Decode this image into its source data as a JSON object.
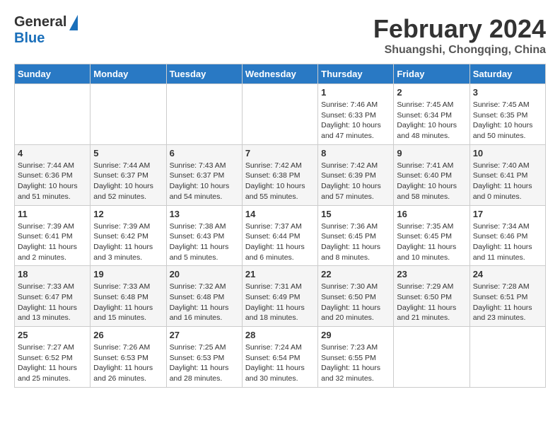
{
  "header": {
    "logo_general": "General",
    "logo_blue": "Blue",
    "title": "February 2024",
    "location": "Shuangshi, Chongqing, China"
  },
  "days_of_week": [
    "Sunday",
    "Monday",
    "Tuesday",
    "Wednesday",
    "Thursday",
    "Friday",
    "Saturday"
  ],
  "weeks": [
    [
      {
        "day": "",
        "sunrise": "",
        "sunset": "",
        "daylight": ""
      },
      {
        "day": "",
        "sunrise": "",
        "sunset": "",
        "daylight": ""
      },
      {
        "day": "",
        "sunrise": "",
        "sunset": "",
        "daylight": ""
      },
      {
        "day": "",
        "sunrise": "",
        "sunset": "",
        "daylight": ""
      },
      {
        "day": "1",
        "sunrise": "Sunrise: 7:46 AM",
        "sunset": "Sunset: 6:33 PM",
        "daylight": "Daylight: 10 hours and 47 minutes."
      },
      {
        "day": "2",
        "sunrise": "Sunrise: 7:45 AM",
        "sunset": "Sunset: 6:34 PM",
        "daylight": "Daylight: 10 hours and 48 minutes."
      },
      {
        "day": "3",
        "sunrise": "Sunrise: 7:45 AM",
        "sunset": "Sunset: 6:35 PM",
        "daylight": "Daylight: 10 hours and 50 minutes."
      }
    ],
    [
      {
        "day": "4",
        "sunrise": "Sunrise: 7:44 AM",
        "sunset": "Sunset: 6:36 PM",
        "daylight": "Daylight: 10 hours and 51 minutes."
      },
      {
        "day": "5",
        "sunrise": "Sunrise: 7:44 AM",
        "sunset": "Sunset: 6:37 PM",
        "daylight": "Daylight: 10 hours and 52 minutes."
      },
      {
        "day": "6",
        "sunrise": "Sunrise: 7:43 AM",
        "sunset": "Sunset: 6:37 PM",
        "daylight": "Daylight: 10 hours and 54 minutes."
      },
      {
        "day": "7",
        "sunrise": "Sunrise: 7:42 AM",
        "sunset": "Sunset: 6:38 PM",
        "daylight": "Daylight: 10 hours and 55 minutes."
      },
      {
        "day": "8",
        "sunrise": "Sunrise: 7:42 AM",
        "sunset": "Sunset: 6:39 PM",
        "daylight": "Daylight: 10 hours and 57 minutes."
      },
      {
        "day": "9",
        "sunrise": "Sunrise: 7:41 AM",
        "sunset": "Sunset: 6:40 PM",
        "daylight": "Daylight: 10 hours and 58 minutes."
      },
      {
        "day": "10",
        "sunrise": "Sunrise: 7:40 AM",
        "sunset": "Sunset: 6:41 PM",
        "daylight": "Daylight: 11 hours and 0 minutes."
      }
    ],
    [
      {
        "day": "11",
        "sunrise": "Sunrise: 7:39 AM",
        "sunset": "Sunset: 6:41 PM",
        "daylight": "Daylight: 11 hours and 2 minutes."
      },
      {
        "day": "12",
        "sunrise": "Sunrise: 7:39 AM",
        "sunset": "Sunset: 6:42 PM",
        "daylight": "Daylight: 11 hours and 3 minutes."
      },
      {
        "day": "13",
        "sunrise": "Sunrise: 7:38 AM",
        "sunset": "Sunset: 6:43 PM",
        "daylight": "Daylight: 11 hours and 5 minutes."
      },
      {
        "day": "14",
        "sunrise": "Sunrise: 7:37 AM",
        "sunset": "Sunset: 6:44 PM",
        "daylight": "Daylight: 11 hours and 6 minutes."
      },
      {
        "day": "15",
        "sunrise": "Sunrise: 7:36 AM",
        "sunset": "Sunset: 6:45 PM",
        "daylight": "Daylight: 11 hours and 8 minutes."
      },
      {
        "day": "16",
        "sunrise": "Sunrise: 7:35 AM",
        "sunset": "Sunset: 6:45 PM",
        "daylight": "Daylight: 11 hours and 10 minutes."
      },
      {
        "day": "17",
        "sunrise": "Sunrise: 7:34 AM",
        "sunset": "Sunset: 6:46 PM",
        "daylight": "Daylight: 11 hours and 11 minutes."
      }
    ],
    [
      {
        "day": "18",
        "sunrise": "Sunrise: 7:33 AM",
        "sunset": "Sunset: 6:47 PM",
        "daylight": "Daylight: 11 hours and 13 minutes."
      },
      {
        "day": "19",
        "sunrise": "Sunrise: 7:33 AM",
        "sunset": "Sunset: 6:48 PM",
        "daylight": "Daylight: 11 hours and 15 minutes."
      },
      {
        "day": "20",
        "sunrise": "Sunrise: 7:32 AM",
        "sunset": "Sunset: 6:48 PM",
        "daylight": "Daylight: 11 hours and 16 minutes."
      },
      {
        "day": "21",
        "sunrise": "Sunrise: 7:31 AM",
        "sunset": "Sunset: 6:49 PM",
        "daylight": "Daylight: 11 hours and 18 minutes."
      },
      {
        "day": "22",
        "sunrise": "Sunrise: 7:30 AM",
        "sunset": "Sunset: 6:50 PM",
        "daylight": "Daylight: 11 hours and 20 minutes."
      },
      {
        "day": "23",
        "sunrise": "Sunrise: 7:29 AM",
        "sunset": "Sunset: 6:50 PM",
        "daylight": "Daylight: 11 hours and 21 minutes."
      },
      {
        "day": "24",
        "sunrise": "Sunrise: 7:28 AM",
        "sunset": "Sunset: 6:51 PM",
        "daylight": "Daylight: 11 hours and 23 minutes."
      }
    ],
    [
      {
        "day": "25",
        "sunrise": "Sunrise: 7:27 AM",
        "sunset": "Sunset: 6:52 PM",
        "daylight": "Daylight: 11 hours and 25 minutes."
      },
      {
        "day": "26",
        "sunrise": "Sunrise: 7:26 AM",
        "sunset": "Sunset: 6:53 PM",
        "daylight": "Daylight: 11 hours and 26 minutes."
      },
      {
        "day": "27",
        "sunrise": "Sunrise: 7:25 AM",
        "sunset": "Sunset: 6:53 PM",
        "daylight": "Daylight: 11 hours and 28 minutes."
      },
      {
        "day": "28",
        "sunrise": "Sunrise: 7:24 AM",
        "sunset": "Sunset: 6:54 PM",
        "daylight": "Daylight: 11 hours and 30 minutes."
      },
      {
        "day": "29",
        "sunrise": "Sunrise: 7:23 AM",
        "sunset": "Sunset: 6:55 PM",
        "daylight": "Daylight: 11 hours and 32 minutes."
      },
      {
        "day": "",
        "sunrise": "",
        "sunset": "",
        "daylight": ""
      },
      {
        "day": "",
        "sunrise": "",
        "sunset": "",
        "daylight": ""
      }
    ]
  ]
}
